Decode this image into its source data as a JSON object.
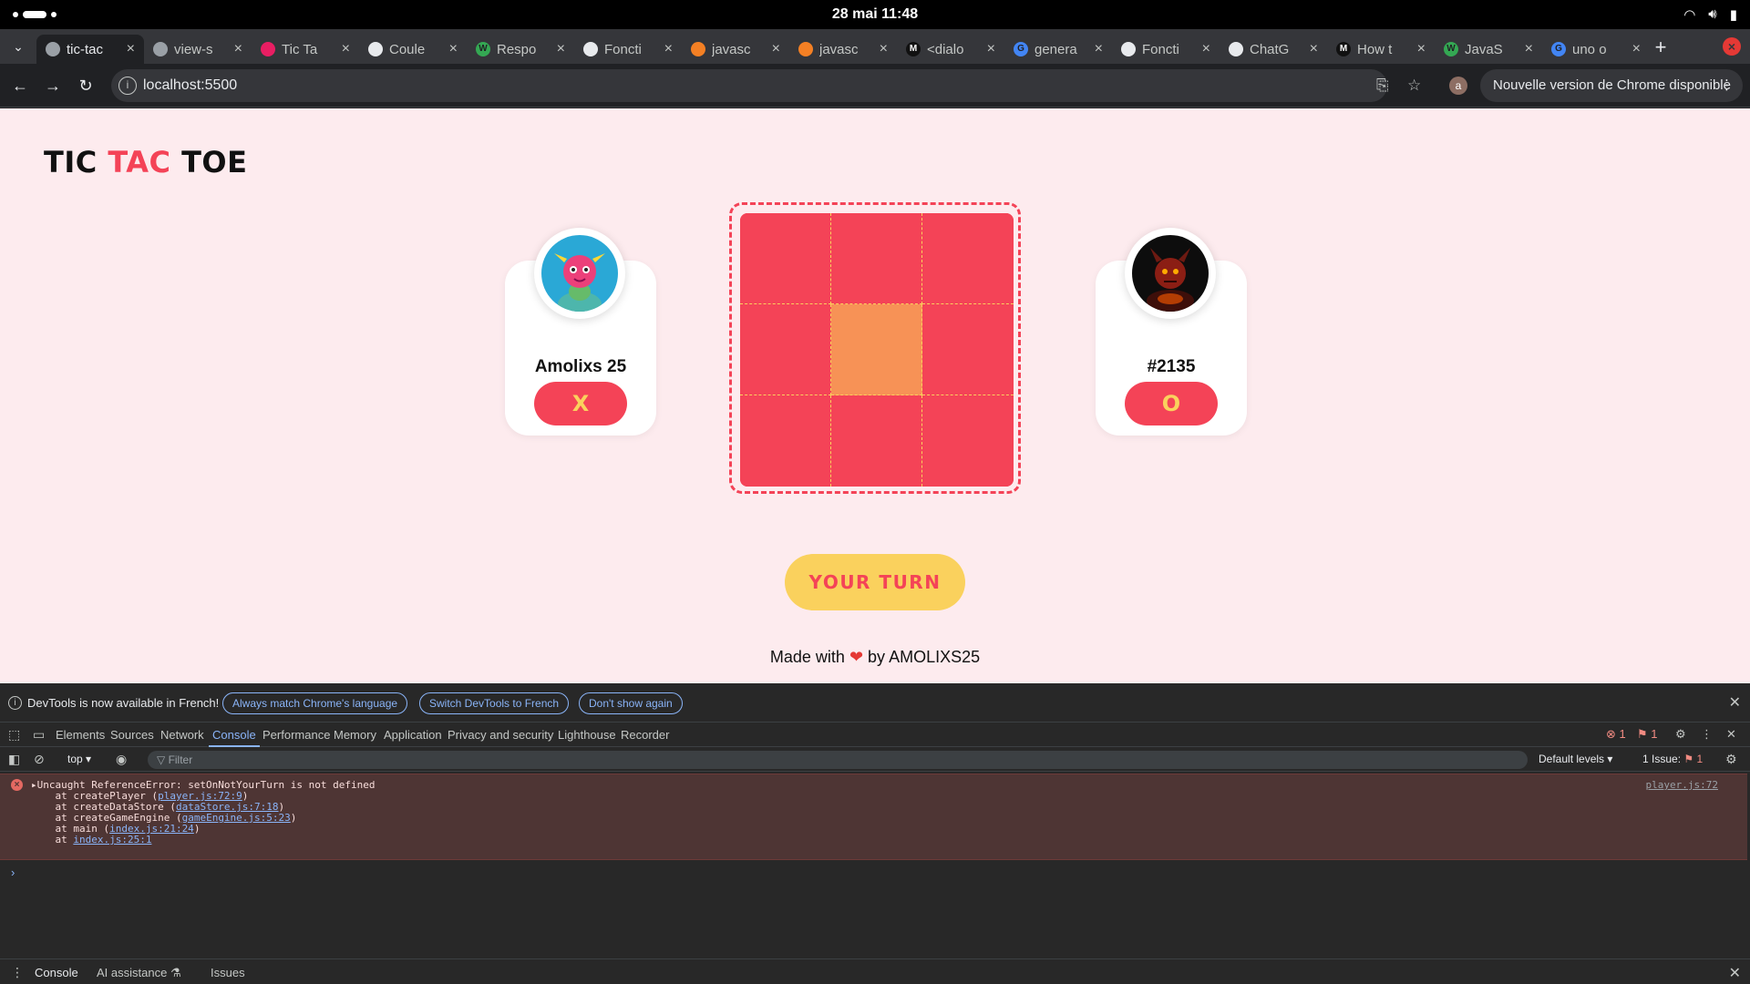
{
  "os": {
    "datetime": "28 mai  11:48"
  },
  "browser": {
    "tabs": [
      {
        "label": "tic-tac",
        "fav_color": "#9aa0a6",
        "fav_char": ""
      },
      {
        "label": "view-s",
        "fav_color": "#9aa0a6",
        "fav_char": ""
      },
      {
        "label": "Tic Ta",
        "fav_color": "#e91e63",
        "fav_char": ""
      },
      {
        "label": "Coule",
        "fav_color": "#e8eaed",
        "fav_char": ""
      },
      {
        "label": "Respo",
        "fav_color": "#34a853",
        "fav_char": "W"
      },
      {
        "label": "Foncti",
        "fav_color": "#e8eaed",
        "fav_char": ""
      },
      {
        "label": "javasc",
        "fav_color": "#f48024",
        "fav_char": ""
      },
      {
        "label": "javasc",
        "fav_color": "#f48024",
        "fav_char": ""
      },
      {
        "label": "<dialo",
        "fav_color": "#111111",
        "fav_char": "M"
      },
      {
        "label": "genera",
        "fav_color": "#4285f4",
        "fav_char": "G"
      },
      {
        "label": "Foncti",
        "fav_color": "#e8eaed",
        "fav_char": ""
      },
      {
        "label": "ChatG",
        "fav_color": "#e8eaed",
        "fav_char": ""
      },
      {
        "label": "How t",
        "fav_color": "#111111",
        "fav_char": "M"
      },
      {
        "label": "JavaS",
        "fav_color": "#34a853",
        "fav_char": "W"
      },
      {
        "label": "uno o",
        "fav_color": "#4285f4",
        "fav_char": "G"
      }
    ],
    "url": "localhost:5500",
    "profile_initial": "a",
    "update_label": "Nouvelle version de Chrome disponible"
  },
  "game": {
    "title_part1": "TIC",
    "title_part2": "TAC",
    "title_part3": "TOE",
    "player1": {
      "name": "Amolixs 25",
      "symbol": "X"
    },
    "player2": {
      "name": "#2135",
      "symbol": "O"
    },
    "board": [
      "",
      "",
      "",
      "",
      "",
      "",
      "",
      "",
      ""
    ],
    "hovered_cell": 4,
    "turn_label": "YOUR TURN",
    "footer_prefix": "Made with",
    "footer_heart": "❤",
    "footer_suffix": "by AMOLIXS25",
    "colors": {
      "primary": "#f44357",
      "accent": "#fad15d",
      "hover": "#f79256",
      "background": "#fdebee"
    }
  },
  "devtools": {
    "banner": {
      "message": "DevTools is now available in French!",
      "btn1": "Always match Chrome's language",
      "btn2": "Switch DevTools to French",
      "btn3": "Don't show again"
    },
    "tabs": [
      "Elements",
      "Sources",
      "Network",
      "Console",
      "Performance",
      "Memory",
      "Application",
      "Privacy and security",
      "Lighthouse",
      "Recorder"
    ],
    "active_tab": "Console",
    "error_count": "1",
    "warning_count": "1",
    "context": "top ▾",
    "filter_placeholder": "Filter",
    "levels": "Default levels ▾",
    "issues_label": "1 Issue:",
    "issues_count": "1",
    "error": {
      "message": "Uncaught ReferenceError: setOnNotYourTurn is not defined",
      "source": "player.js:72",
      "stack": [
        {
          "prefix": "    at createPlayer (",
          "link": "player.js:72:9",
          "suffix": ")"
        },
        {
          "prefix": "    at createDataStore (",
          "link": "dataStore.js:7:18",
          "suffix": ")"
        },
        {
          "prefix": "    at createGameEngine (",
          "link": "gameEngine.js:5:23",
          "suffix": ")"
        },
        {
          "prefix": "    at main (",
          "link": "index.js:21:24",
          "suffix": ")"
        },
        {
          "prefix": "    at ",
          "link": "index.js:25:1",
          "suffix": ""
        }
      ]
    },
    "drawer_tabs": [
      "Console",
      "AI assistance",
      "Issues"
    ]
  }
}
